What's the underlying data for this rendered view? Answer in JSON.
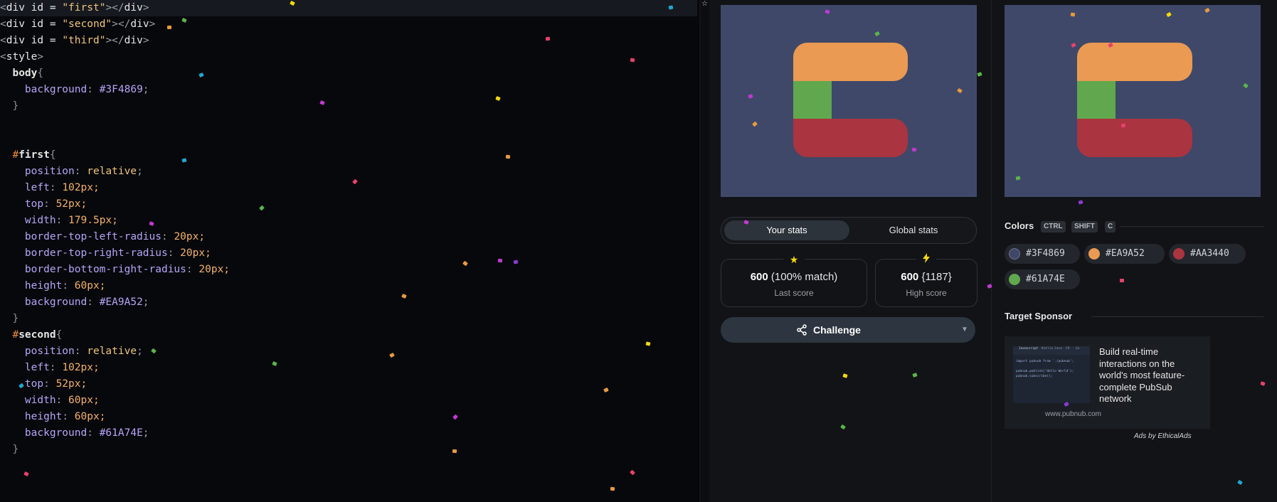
{
  "editor": {
    "lines": [
      [
        {
          "t": "<",
          "c": "punct"
        },
        {
          "t": "div",
          "c": "tag"
        },
        {
          "t": " id = ",
          "c": "attr"
        },
        {
          "t": "\"first\"",
          "c": "str"
        },
        {
          "t": "></",
          "c": "punct"
        },
        {
          "t": "div",
          "c": "tag"
        },
        {
          "t": ">",
          "c": "punct"
        }
      ],
      [
        {
          "t": "<",
          "c": "punct"
        },
        {
          "t": "div",
          "c": "tag"
        },
        {
          "t": " id = ",
          "c": "attr"
        },
        {
          "t": "\"second\"",
          "c": "str"
        },
        {
          "t": "></",
          "c": "punct"
        },
        {
          "t": "div",
          "c": "tag"
        },
        {
          "t": ">",
          "c": "punct"
        }
      ],
      [
        {
          "t": "<",
          "c": "punct"
        },
        {
          "t": "div",
          "c": "tag"
        },
        {
          "t": " id = ",
          "c": "attr"
        },
        {
          "t": "\"third\"",
          "c": "str"
        },
        {
          "t": "></",
          "c": "punct"
        },
        {
          "t": "div",
          "c": "tag"
        },
        {
          "t": ">",
          "c": "punct"
        }
      ],
      [
        {
          "t": "<",
          "c": "punct"
        },
        {
          "t": "style",
          "c": "tag"
        },
        {
          "t": ">",
          "c": "punct"
        }
      ],
      [
        {
          "t": "  body",
          "c": "sel"
        },
        {
          "t": "{",
          "c": "brace"
        }
      ],
      [
        {
          "t": "    background",
          "c": "prop"
        },
        {
          "t": ": ",
          "c": "punct"
        },
        {
          "t": "#3F4869",
          "c": "colr"
        },
        {
          "t": ";",
          "c": "punct"
        }
      ],
      [
        {
          "t": "  }",
          "c": "brace"
        }
      ],
      [],
      [],
      [
        {
          "t": "  #",
          "c": "hash"
        },
        {
          "t": "first",
          "c": "sel"
        },
        {
          "t": "{",
          "c": "brace"
        }
      ],
      [
        {
          "t": "    position",
          "c": "prop"
        },
        {
          "t": ": ",
          "c": "punct"
        },
        {
          "t": "relative",
          "c": "str"
        },
        {
          "t": ";",
          "c": "punct"
        }
      ],
      [
        {
          "t": "    left",
          "c": "prop"
        },
        {
          "t": ": ",
          "c": "punct"
        },
        {
          "t": "102",
          "c": "num"
        },
        {
          "t": "px;",
          "c": "unit"
        }
      ],
      [
        {
          "t": "    top",
          "c": "prop"
        },
        {
          "t": ": ",
          "c": "punct"
        },
        {
          "t": "52",
          "c": "num"
        },
        {
          "t": "px;",
          "c": "unit"
        }
      ],
      [
        {
          "t": "    width",
          "c": "prop"
        },
        {
          "t": ": ",
          "c": "punct"
        },
        {
          "t": "179.5",
          "c": "num"
        },
        {
          "t": "px;",
          "c": "unit"
        }
      ],
      [
        {
          "t": "    border-top-left-radius",
          "c": "prop"
        },
        {
          "t": ": ",
          "c": "punct"
        },
        {
          "t": "20",
          "c": "num"
        },
        {
          "t": "px;",
          "c": "unit"
        }
      ],
      [
        {
          "t": "    border-top-right-radius",
          "c": "prop"
        },
        {
          "t": ": ",
          "c": "punct"
        },
        {
          "t": "20",
          "c": "num"
        },
        {
          "t": "px;",
          "c": "unit"
        }
      ],
      [
        {
          "t": "    border-bottom-right-radius",
          "c": "prop"
        },
        {
          "t": ": ",
          "c": "punct"
        },
        {
          "t": "20",
          "c": "num"
        },
        {
          "t": "px;",
          "c": "unit"
        }
      ],
      [
        {
          "t": "    height",
          "c": "prop"
        },
        {
          "t": ": ",
          "c": "punct"
        },
        {
          "t": "60",
          "c": "num"
        },
        {
          "t": "px;",
          "c": "unit"
        }
      ],
      [
        {
          "t": "    background",
          "c": "prop"
        },
        {
          "t": ": ",
          "c": "punct"
        },
        {
          "t": "#EA9A52",
          "c": "colr"
        },
        {
          "t": ";",
          "c": "punct"
        }
      ],
      [
        {
          "t": "  }",
          "c": "brace"
        }
      ],
      [
        {
          "t": "  #",
          "c": "hash"
        },
        {
          "t": "second",
          "c": "sel"
        },
        {
          "t": "{",
          "c": "brace"
        }
      ],
      [
        {
          "t": "    position",
          "c": "prop"
        },
        {
          "t": ": ",
          "c": "punct"
        },
        {
          "t": "relative",
          "c": "str"
        },
        {
          "t": ";",
          "c": "punct"
        }
      ],
      [
        {
          "t": "    left",
          "c": "prop"
        },
        {
          "t": ": ",
          "c": "punct"
        },
        {
          "t": "102",
          "c": "num"
        },
        {
          "t": "px;",
          "c": "unit"
        }
      ],
      [
        {
          "t": "    top",
          "c": "prop"
        },
        {
          "t": ": ",
          "c": "punct"
        },
        {
          "t": "52",
          "c": "num"
        },
        {
          "t": "px;",
          "c": "unit"
        }
      ],
      [
        {
          "t": "    width",
          "c": "prop"
        },
        {
          "t": ": ",
          "c": "punct"
        },
        {
          "t": "60",
          "c": "num"
        },
        {
          "t": "px;",
          "c": "unit"
        }
      ],
      [
        {
          "t": "    height",
          "c": "prop"
        },
        {
          "t": ": ",
          "c": "punct"
        },
        {
          "t": "60",
          "c": "num"
        },
        {
          "t": "px;",
          "c": "unit"
        }
      ],
      [
        {
          "t": "    background",
          "c": "prop"
        },
        {
          "t": ": ",
          "c": "punct"
        },
        {
          "t": "#61A74E",
          "c": "colr"
        },
        {
          "t": ";",
          "c": "punct"
        }
      ],
      [
        {
          "t": "  }",
          "c": "brace"
        }
      ]
    ]
  },
  "stats": {
    "tabs": {
      "your": "Your stats",
      "global": "Global stats"
    },
    "last": {
      "icon": "star-icon",
      "value": "600",
      "match": "(100% match)",
      "caption": "Last score"
    },
    "high": {
      "icon": "lightning-icon",
      "value": "600",
      "extra": "{1187}",
      "caption": "High score"
    }
  },
  "challenge": {
    "label": "Challenge",
    "icon": "share-icon"
  },
  "colors": {
    "heading": "Colors",
    "shortcuts": [
      "CTRL",
      "SHIFT",
      "C"
    ],
    "swatches": [
      {
        "hex": "#3F4869",
        "color": "#3F4869"
      },
      {
        "hex": "#EA9A52",
        "color": "#EA9A52"
      },
      {
        "hex": "#AA3440",
        "color": "#AA3440"
      },
      {
        "hex": "#61A74E",
        "color": "#61A74E"
      }
    ]
  },
  "sponsor": {
    "heading": "Target Sponsor",
    "ad_text": "Build real-time interactions on the world's most feature-complete PubSub network",
    "url": "www.pubnub.com",
    "ads_by": "Ads by EthicalAds",
    "image_code": [
      "import pubnub from './pubnub';",
      "",
      "pubnub.publish('Hello World');",
      "pubnub.subscribe();"
    ],
    "image_tabs": [
      "Javascript",
      "Kotlin",
      "Java",
      "C#",
      "Go"
    ]
  },
  "brand_colors": {
    "bg": "#3F4869",
    "orange": "#EA9A52",
    "green": "#61A74E",
    "red": "#AA3440"
  }
}
